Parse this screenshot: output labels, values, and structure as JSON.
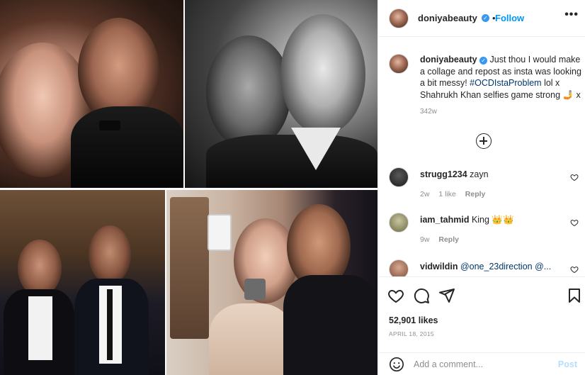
{
  "colors": {
    "accent": "#0095f6",
    "verified": "#3897f0",
    "hashtag": "#00376b",
    "muted": "#8e8e8e",
    "border": "#efefef"
  },
  "photos": [
    {
      "name": "selfie-woman-and-man"
    },
    {
      "name": "black-and-white-selfie"
    },
    {
      "name": "two-men-in-suits"
    },
    {
      "name": "group-selfie-with-phone"
    }
  ],
  "header": {
    "username": "doniyabeauty",
    "verified_icon": "verified-check-icon",
    "separator": "•",
    "follow_label": "Follow",
    "more_icon": "•••"
  },
  "caption": {
    "username": "doniyabeauty",
    "text_before_hashtag": " Just thou I would make a collage and repost as insta was looking a bit messy! ",
    "hashtag": "#OCDIstaProblem",
    "text_after_hashtag": " lol x Shahrukh Khan selfies game strong 🤳 x",
    "time": "342w"
  },
  "comments": [
    {
      "username": "strugg1234",
      "text": " zayn",
      "time": "2w",
      "likes": "1 like",
      "reply": "Reply"
    },
    {
      "username": "iam_tahmid",
      "text": " King 👑👑",
      "time": "9w",
      "likes": "",
      "reply": "Reply"
    },
    {
      "username": "vidwildin",
      "text": " @one_23direction @..."
    }
  ],
  "post": {
    "likes": "52,901 likes",
    "date": "APRIL 18, 2015"
  },
  "add_comment": {
    "placeholder": "Add a comment...",
    "post_label": "Post"
  }
}
